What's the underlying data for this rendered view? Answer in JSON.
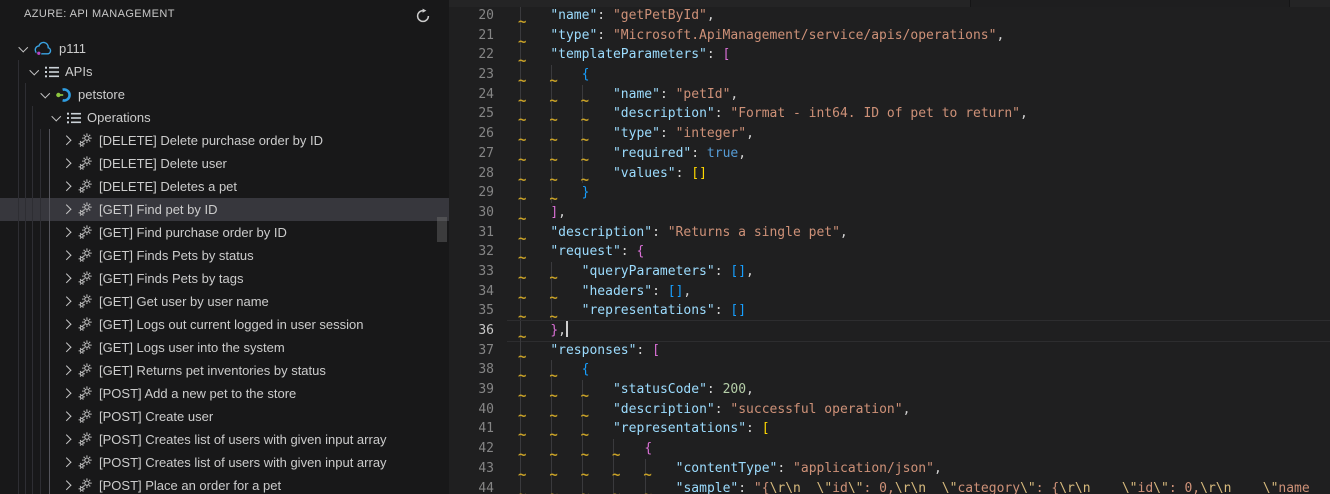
{
  "sidebar": {
    "title": "AZURE: API MANAGEMENT",
    "refresh_icon": "refresh-icon",
    "tree": {
      "items": [
        {
          "label": "p111",
          "depth": 0,
          "icon": "cloud",
          "expanded": true,
          "selected": false
        },
        {
          "label": "APIs",
          "depth": 1,
          "icon": "list",
          "expanded": true,
          "selected": false
        },
        {
          "label": "petstore",
          "depth": 2,
          "icon": "api",
          "expanded": true,
          "selected": false
        },
        {
          "label": "Operations",
          "depth": 3,
          "icon": "list",
          "expanded": true,
          "selected": false
        },
        {
          "label": "[DELETE] Delete purchase order by ID",
          "depth": 4,
          "icon": "gears",
          "expanded": false,
          "selected": false
        },
        {
          "label": "[DELETE] Delete user",
          "depth": 4,
          "icon": "gears",
          "expanded": false,
          "selected": false
        },
        {
          "label": "[DELETE] Deletes a pet",
          "depth": 4,
          "icon": "gears",
          "expanded": false,
          "selected": false
        },
        {
          "label": "[GET] Find pet by ID",
          "depth": 4,
          "icon": "gears",
          "expanded": false,
          "selected": true
        },
        {
          "label": "[GET] Find purchase order by ID",
          "depth": 4,
          "icon": "gears",
          "expanded": false,
          "selected": false
        },
        {
          "label": "[GET] Finds Pets by status",
          "depth": 4,
          "icon": "gears",
          "expanded": false,
          "selected": false
        },
        {
          "label": "[GET] Finds Pets by tags",
          "depth": 4,
          "icon": "gears",
          "expanded": false,
          "selected": false
        },
        {
          "label": "[GET] Get user by user name",
          "depth": 4,
          "icon": "gears",
          "expanded": false,
          "selected": false
        },
        {
          "label": "[GET] Logs out current logged in user session",
          "depth": 4,
          "icon": "gears",
          "expanded": false,
          "selected": false
        },
        {
          "label": "[GET] Logs user into the system",
          "depth": 4,
          "icon": "gears",
          "expanded": false,
          "selected": false
        },
        {
          "label": "[GET] Returns pet inventories by status",
          "depth": 4,
          "icon": "gears",
          "expanded": false,
          "selected": false
        },
        {
          "label": "[POST] Add a new pet to the store",
          "depth": 4,
          "icon": "gears",
          "expanded": false,
          "selected": false
        },
        {
          "label": "[POST] Create user",
          "depth": 4,
          "icon": "gears",
          "expanded": false,
          "selected": false
        },
        {
          "label": "[POST] Creates list of users with given input array",
          "depth": 4,
          "icon": "gears",
          "expanded": false,
          "selected": false
        },
        {
          "label": "[POST] Creates list of users with given input array",
          "depth": 4,
          "icon": "gears",
          "expanded": false,
          "selected": false
        },
        {
          "label": "[POST] Place an order for a pet",
          "depth": 4,
          "icon": "gears",
          "expanded": false,
          "selected": false
        }
      ]
    }
  },
  "editor": {
    "first_line": 20,
    "active_line": 36,
    "lines": [
      {
        "n": 20,
        "indent": 1,
        "tokens": [
          [
            "\"name\"",
            "k"
          ],
          [
            ": ",
            "p"
          ],
          [
            "\"getPetById\"",
            "s"
          ],
          [
            ",",
            "p"
          ]
        ]
      },
      {
        "n": 21,
        "indent": 1,
        "tokens": [
          [
            "\"type\"",
            "k"
          ],
          [
            ": ",
            "p"
          ],
          [
            "\"Microsoft.ApiManagement/service/apis/operations\"",
            "s"
          ],
          [
            ",",
            "p"
          ]
        ]
      },
      {
        "n": 22,
        "indent": 1,
        "tokens": [
          [
            "\"templateParameters\"",
            "k"
          ],
          [
            ": ",
            "p"
          ],
          [
            "[",
            "b2"
          ]
        ]
      },
      {
        "n": 23,
        "indent": 2,
        "tokens": [
          [
            "{",
            "b3"
          ]
        ]
      },
      {
        "n": 24,
        "indent": 3,
        "tokens": [
          [
            "\"name\"",
            "k"
          ],
          [
            ": ",
            "p"
          ],
          [
            "\"petId\"",
            "s"
          ],
          [
            ",",
            "p"
          ]
        ]
      },
      {
        "n": 25,
        "indent": 3,
        "tokens": [
          [
            "\"description\"",
            "k"
          ],
          [
            ": ",
            "p"
          ],
          [
            "\"Format - int64. ID of pet to return\"",
            "s"
          ],
          [
            ",",
            "p"
          ]
        ]
      },
      {
        "n": 26,
        "indent": 3,
        "tokens": [
          [
            "\"type\"",
            "k"
          ],
          [
            ": ",
            "p"
          ],
          [
            "\"integer\"",
            "s"
          ],
          [
            ",",
            "p"
          ]
        ]
      },
      {
        "n": 27,
        "indent": 3,
        "tokens": [
          [
            "\"required\"",
            "k"
          ],
          [
            ": ",
            "p"
          ],
          [
            "true",
            "kw"
          ],
          [
            ",",
            "p"
          ]
        ]
      },
      {
        "n": 28,
        "indent": 3,
        "tokens": [
          [
            "\"values\"",
            "k"
          ],
          [
            ": ",
            "p"
          ],
          [
            "[]",
            "b1"
          ]
        ]
      },
      {
        "n": 29,
        "indent": 2,
        "tokens": [
          [
            "}",
            "b3"
          ]
        ]
      },
      {
        "n": 30,
        "indent": 1,
        "tokens": [
          [
            "]",
            "b2"
          ],
          [
            ",",
            "p"
          ]
        ]
      },
      {
        "n": 31,
        "indent": 1,
        "tokens": [
          [
            "\"description\"",
            "k"
          ],
          [
            ": ",
            "p"
          ],
          [
            "\"Returns a single pet\"",
            "s"
          ],
          [
            ",",
            "p"
          ]
        ]
      },
      {
        "n": 32,
        "indent": 1,
        "tokens": [
          [
            "\"request\"",
            "k"
          ],
          [
            ": ",
            "p"
          ],
          [
            "{",
            "b2"
          ]
        ]
      },
      {
        "n": 33,
        "indent": 2,
        "tokens": [
          [
            "\"queryParameters\"",
            "k"
          ],
          [
            ": ",
            "p"
          ],
          [
            "[]",
            "b3"
          ],
          [
            ",",
            "p"
          ]
        ]
      },
      {
        "n": 34,
        "indent": 2,
        "tokens": [
          [
            "\"headers\"",
            "k"
          ],
          [
            ": ",
            "p"
          ],
          [
            "[]",
            "b3"
          ],
          [
            ",",
            "p"
          ]
        ]
      },
      {
        "n": 35,
        "indent": 2,
        "tokens": [
          [
            "\"representations\"",
            "k"
          ],
          [
            ": ",
            "p"
          ],
          [
            "[]",
            "b3"
          ]
        ]
      },
      {
        "n": 36,
        "indent": 1,
        "cursor": true,
        "tokens": [
          [
            "}",
            "b2"
          ],
          [
            ",",
            "p"
          ]
        ]
      },
      {
        "n": 37,
        "indent": 1,
        "tokens": [
          [
            "\"responses\"",
            "k"
          ],
          [
            ": ",
            "p"
          ],
          [
            "[",
            "b2"
          ]
        ]
      },
      {
        "n": 38,
        "indent": 2,
        "tokens": [
          [
            "{",
            "b3"
          ]
        ]
      },
      {
        "n": 39,
        "indent": 3,
        "tokens": [
          [
            "\"statusCode\"",
            "k"
          ],
          [
            ": ",
            "p"
          ],
          [
            "200",
            "num"
          ],
          [
            ",",
            "p"
          ]
        ]
      },
      {
        "n": 40,
        "indent": 3,
        "tokens": [
          [
            "\"description\"",
            "k"
          ],
          [
            ": ",
            "p"
          ],
          [
            "\"successful operation\"",
            "s"
          ],
          [
            ",",
            "p"
          ]
        ]
      },
      {
        "n": 41,
        "indent": 3,
        "tokens": [
          [
            "\"representations\"",
            "k"
          ],
          [
            ": ",
            "p"
          ],
          [
            "[",
            "b1"
          ]
        ]
      },
      {
        "n": 42,
        "indent": 4,
        "tokens": [
          [
            "{",
            "b2"
          ]
        ]
      },
      {
        "n": 43,
        "indent": 5,
        "tokens": [
          [
            "\"contentType\"",
            "k"
          ],
          [
            ": ",
            "p"
          ],
          [
            "\"application/json\"",
            "s"
          ],
          [
            ",",
            "p"
          ]
        ]
      },
      {
        "n": 44,
        "indent": 5,
        "tokens": [
          [
            "\"sample\"",
            "k"
          ],
          [
            ": ",
            "p"
          ],
          [
            "\"{",
            "s"
          ],
          [
            "\\r\\n",
            "e"
          ],
          [
            "  ",
            "s"
          ],
          [
            "\\\"",
            "e"
          ],
          [
            "id",
            "s"
          ],
          [
            "\\\"",
            "e"
          ],
          [
            ": 0,",
            "s"
          ],
          [
            "\\r\\n",
            "e"
          ],
          [
            "  ",
            "s"
          ],
          [
            "\\\"",
            "e"
          ],
          [
            "category",
            "s"
          ],
          [
            "\\\"",
            "e"
          ],
          [
            ": {",
            "s"
          ],
          [
            "\\r\\n",
            "e"
          ],
          [
            "    ",
            "s"
          ],
          [
            "\\\"",
            "e"
          ],
          [
            "id",
            "s"
          ],
          [
            "\\\"",
            "e"
          ],
          [
            ": 0,",
            "s"
          ],
          [
            "\\r\\n",
            "e"
          ],
          [
            "    ",
            "s"
          ],
          [
            "\\\"",
            "e"
          ],
          [
            "name",
            "s"
          ]
        ]
      }
    ]
  },
  "colors": {
    "sidebar_bg": "#181819",
    "editor_bg": "#1f1f20",
    "selection_bg": "#37373d",
    "squiggle": "#c9a227",
    "bracket_depth_colors": [
      "#ffd700",
      "#da70d6",
      "#179fff"
    ],
    "json_key": "#9cdcfe",
    "json_string": "#ce9178",
    "string_escape": "#d7ba7d",
    "keyword": "#569cd6",
    "number": "#b5cea8",
    "line_number": "#858585",
    "line_number_active": "#c6c6c6"
  }
}
